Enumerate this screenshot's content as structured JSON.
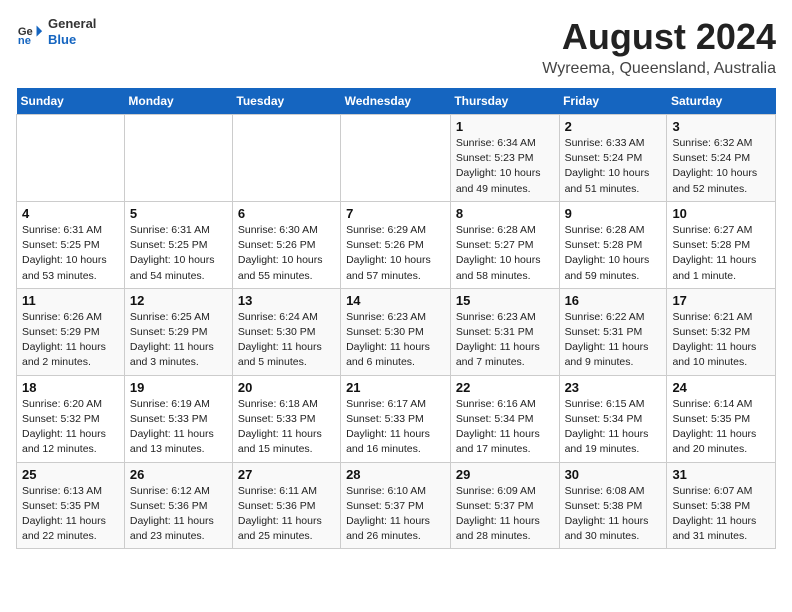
{
  "header": {
    "title": "August 2024",
    "subtitle": "Wyreema, Queensland, Australia",
    "logo_general": "General",
    "logo_blue": "Blue"
  },
  "days_of_week": [
    "Sunday",
    "Monday",
    "Tuesday",
    "Wednesday",
    "Thursday",
    "Friday",
    "Saturday"
  ],
  "weeks": [
    [
      {
        "day": "",
        "info": ""
      },
      {
        "day": "",
        "info": ""
      },
      {
        "day": "",
        "info": ""
      },
      {
        "day": "",
        "info": ""
      },
      {
        "day": "1",
        "info": "Sunrise: 6:34 AM\nSunset: 5:23 PM\nDaylight: 10 hours\nand 49 minutes."
      },
      {
        "day": "2",
        "info": "Sunrise: 6:33 AM\nSunset: 5:24 PM\nDaylight: 10 hours\nand 51 minutes."
      },
      {
        "day": "3",
        "info": "Sunrise: 6:32 AM\nSunset: 5:24 PM\nDaylight: 10 hours\nand 52 minutes."
      }
    ],
    [
      {
        "day": "4",
        "info": "Sunrise: 6:31 AM\nSunset: 5:25 PM\nDaylight: 10 hours\nand 53 minutes."
      },
      {
        "day": "5",
        "info": "Sunrise: 6:31 AM\nSunset: 5:25 PM\nDaylight: 10 hours\nand 54 minutes."
      },
      {
        "day": "6",
        "info": "Sunrise: 6:30 AM\nSunset: 5:26 PM\nDaylight: 10 hours\nand 55 minutes."
      },
      {
        "day": "7",
        "info": "Sunrise: 6:29 AM\nSunset: 5:26 PM\nDaylight: 10 hours\nand 57 minutes."
      },
      {
        "day": "8",
        "info": "Sunrise: 6:28 AM\nSunset: 5:27 PM\nDaylight: 10 hours\nand 58 minutes."
      },
      {
        "day": "9",
        "info": "Sunrise: 6:28 AM\nSunset: 5:28 PM\nDaylight: 10 hours\nand 59 minutes."
      },
      {
        "day": "10",
        "info": "Sunrise: 6:27 AM\nSunset: 5:28 PM\nDaylight: 11 hours\nand 1 minute."
      }
    ],
    [
      {
        "day": "11",
        "info": "Sunrise: 6:26 AM\nSunset: 5:29 PM\nDaylight: 11 hours\nand 2 minutes."
      },
      {
        "day": "12",
        "info": "Sunrise: 6:25 AM\nSunset: 5:29 PM\nDaylight: 11 hours\nand 3 minutes."
      },
      {
        "day": "13",
        "info": "Sunrise: 6:24 AM\nSunset: 5:30 PM\nDaylight: 11 hours\nand 5 minutes."
      },
      {
        "day": "14",
        "info": "Sunrise: 6:23 AM\nSunset: 5:30 PM\nDaylight: 11 hours\nand 6 minutes."
      },
      {
        "day": "15",
        "info": "Sunrise: 6:23 AM\nSunset: 5:31 PM\nDaylight: 11 hours\nand 7 minutes."
      },
      {
        "day": "16",
        "info": "Sunrise: 6:22 AM\nSunset: 5:31 PM\nDaylight: 11 hours\nand 9 minutes."
      },
      {
        "day": "17",
        "info": "Sunrise: 6:21 AM\nSunset: 5:32 PM\nDaylight: 11 hours\nand 10 minutes."
      }
    ],
    [
      {
        "day": "18",
        "info": "Sunrise: 6:20 AM\nSunset: 5:32 PM\nDaylight: 11 hours\nand 12 minutes."
      },
      {
        "day": "19",
        "info": "Sunrise: 6:19 AM\nSunset: 5:33 PM\nDaylight: 11 hours\nand 13 minutes."
      },
      {
        "day": "20",
        "info": "Sunrise: 6:18 AM\nSunset: 5:33 PM\nDaylight: 11 hours\nand 15 minutes."
      },
      {
        "day": "21",
        "info": "Sunrise: 6:17 AM\nSunset: 5:33 PM\nDaylight: 11 hours\nand 16 minutes."
      },
      {
        "day": "22",
        "info": "Sunrise: 6:16 AM\nSunset: 5:34 PM\nDaylight: 11 hours\nand 17 minutes."
      },
      {
        "day": "23",
        "info": "Sunrise: 6:15 AM\nSunset: 5:34 PM\nDaylight: 11 hours\nand 19 minutes."
      },
      {
        "day": "24",
        "info": "Sunrise: 6:14 AM\nSunset: 5:35 PM\nDaylight: 11 hours\nand 20 minutes."
      }
    ],
    [
      {
        "day": "25",
        "info": "Sunrise: 6:13 AM\nSunset: 5:35 PM\nDaylight: 11 hours\nand 22 minutes."
      },
      {
        "day": "26",
        "info": "Sunrise: 6:12 AM\nSunset: 5:36 PM\nDaylight: 11 hours\nand 23 minutes."
      },
      {
        "day": "27",
        "info": "Sunrise: 6:11 AM\nSunset: 5:36 PM\nDaylight: 11 hours\nand 25 minutes."
      },
      {
        "day": "28",
        "info": "Sunrise: 6:10 AM\nSunset: 5:37 PM\nDaylight: 11 hours\nand 26 minutes."
      },
      {
        "day": "29",
        "info": "Sunrise: 6:09 AM\nSunset: 5:37 PM\nDaylight: 11 hours\nand 28 minutes."
      },
      {
        "day": "30",
        "info": "Sunrise: 6:08 AM\nSunset: 5:38 PM\nDaylight: 11 hours\nand 30 minutes."
      },
      {
        "day": "31",
        "info": "Sunrise: 6:07 AM\nSunset: 5:38 PM\nDaylight: 11 hours\nand 31 minutes."
      }
    ]
  ]
}
